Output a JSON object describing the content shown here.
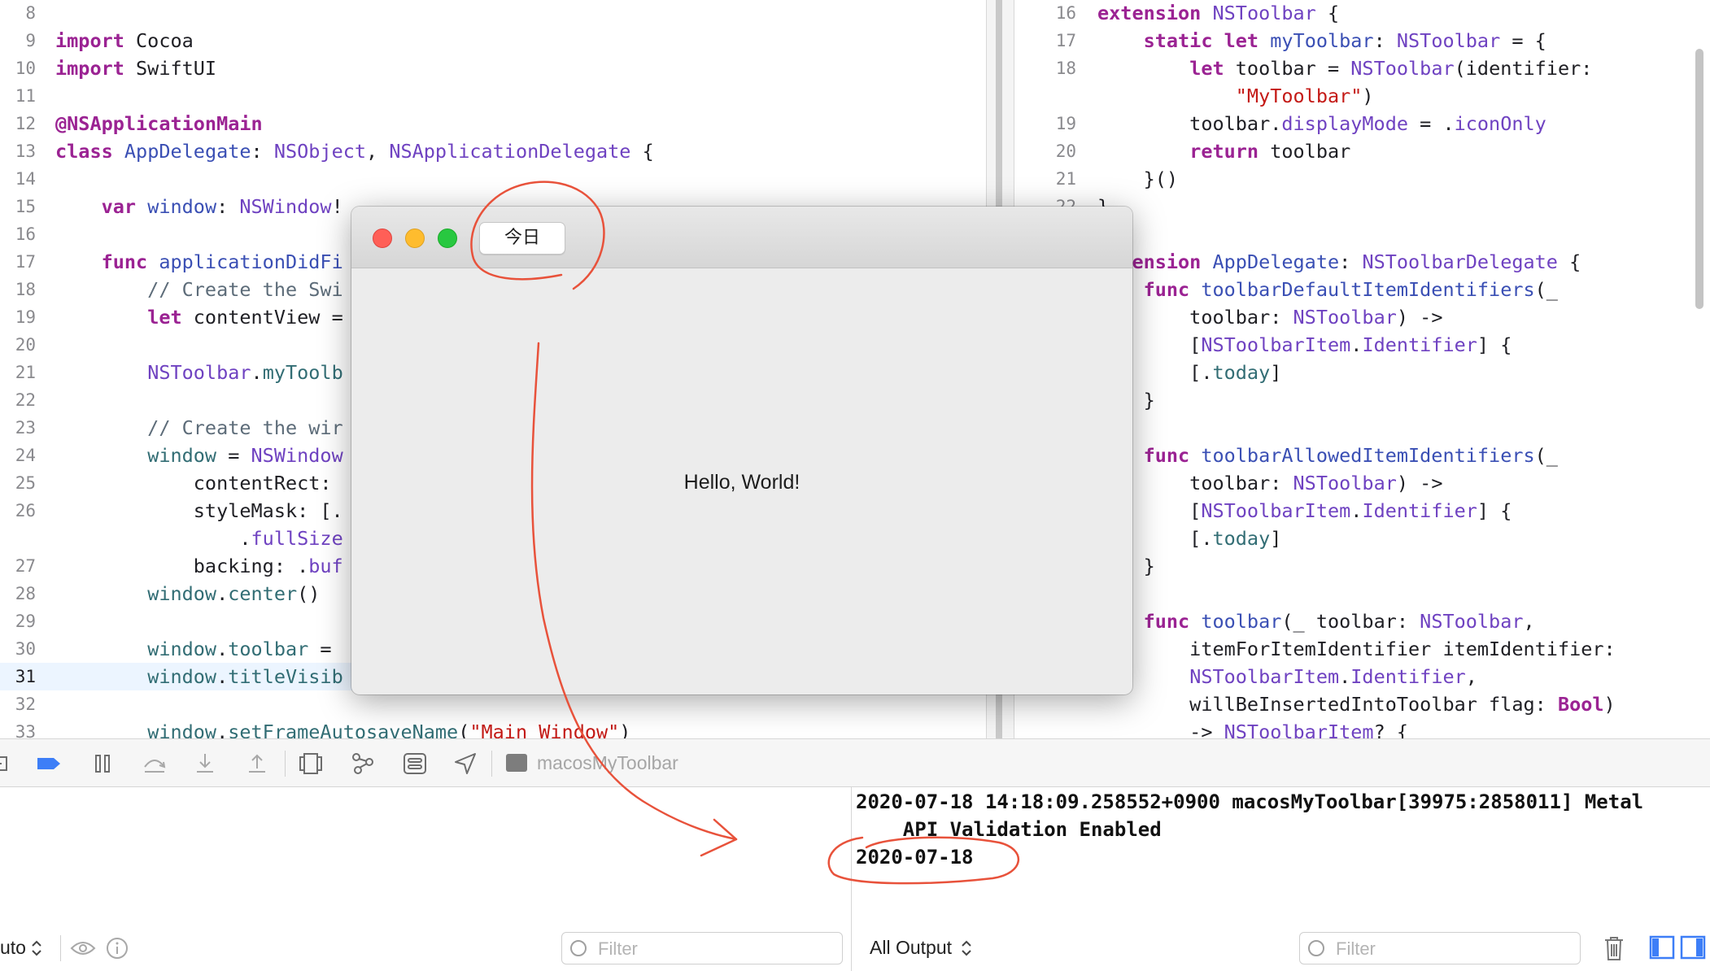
{
  "left_editor": {
    "lines": [
      {
        "num": "8",
        "current": false,
        "tokens": []
      },
      {
        "num": "9",
        "current": false,
        "tokens": [
          {
            "c": "kw",
            "t": "import"
          },
          {
            "c": "pl",
            "t": " Cocoa"
          }
        ]
      },
      {
        "num": "10",
        "current": false,
        "tokens": [
          {
            "c": "kw",
            "t": "import"
          },
          {
            "c": "pl",
            "t": " SwiftUI"
          }
        ]
      },
      {
        "num": "11",
        "current": false,
        "tokens": []
      },
      {
        "num": "12",
        "current": false,
        "tokens": [
          {
            "c": "at",
            "t": "@NSApplicationMain"
          }
        ]
      },
      {
        "num": "13",
        "current": false,
        "tokens": [
          {
            "c": "kw",
            "t": "class"
          },
          {
            "c": "pl",
            "t": " "
          },
          {
            "c": "ty",
            "t": "AppDelegate"
          },
          {
            "c": "pl",
            "t": ": "
          },
          {
            "c": "mt",
            "t": "NSObject"
          },
          {
            "c": "pl",
            "t": ", "
          },
          {
            "c": "mt",
            "t": "NSApplicationDelegate"
          },
          {
            "c": "pl",
            "t": " {"
          }
        ]
      },
      {
        "num": "14",
        "current": false,
        "tokens": []
      },
      {
        "num": "15",
        "current": false,
        "tokens": [
          {
            "c": "pl",
            "t": "    "
          },
          {
            "c": "kw",
            "t": "var"
          },
          {
            "c": "pl",
            "t": " "
          },
          {
            "c": "ty",
            "t": "window"
          },
          {
            "c": "pl",
            "t": ": "
          },
          {
            "c": "mt",
            "t": "NSWindow"
          },
          {
            "c": "pl",
            "t": "!"
          }
        ]
      },
      {
        "num": "16",
        "current": false,
        "tokens": []
      },
      {
        "num": "17",
        "current": false,
        "tokens": [
          {
            "c": "pl",
            "t": "    "
          },
          {
            "c": "kw",
            "t": "func"
          },
          {
            "c": "pl",
            "t": " "
          },
          {
            "c": "ty",
            "t": "applicationDidFi"
          }
        ]
      },
      {
        "num": "18",
        "current": false,
        "tokens": [
          {
            "c": "cm",
            "t": "        // Create the Swi"
          }
        ]
      },
      {
        "num": "19",
        "current": false,
        "tokens": [
          {
            "c": "pl",
            "t": "        "
          },
          {
            "c": "kw",
            "t": "let"
          },
          {
            "c": "pl",
            "t": " contentView ="
          }
        ]
      },
      {
        "num": "20",
        "current": false,
        "tokens": []
      },
      {
        "num": "21",
        "current": false,
        "tokens": [
          {
            "c": "pl",
            "t": "        "
          },
          {
            "c": "mt",
            "t": "NSToolbar"
          },
          {
            "c": "pl",
            "t": "."
          },
          {
            "c": "id",
            "t": "myToolb"
          }
        ]
      },
      {
        "num": "22",
        "current": false,
        "tokens": []
      },
      {
        "num": "23",
        "current": false,
        "tokens": [
          {
            "c": "cm",
            "t": "        // Create the wir"
          }
        ]
      },
      {
        "num": "24",
        "current": false,
        "tokens": [
          {
            "c": "pl",
            "t": "        "
          },
          {
            "c": "id",
            "t": "window"
          },
          {
            "c": "pl",
            "t": " = "
          },
          {
            "c": "mt",
            "t": "NSWindow"
          }
        ]
      },
      {
        "num": "25",
        "current": false,
        "tokens": [
          {
            "c": "pl",
            "t": "            contentRect:"
          }
        ]
      },
      {
        "num": "26",
        "current": false,
        "tokens": [
          {
            "c": "pl",
            "t": "            styleMask: [."
          }
        ]
      },
      {
        "num": "",
        "current": false,
        "tokens": [
          {
            "c": "pl",
            "t": "                ."
          },
          {
            "c": "mt",
            "t": "fullSize"
          }
        ]
      },
      {
        "num": "27",
        "current": false,
        "tokens": [
          {
            "c": "pl",
            "t": "            backing: ."
          },
          {
            "c": "mt",
            "t": "buf"
          }
        ]
      },
      {
        "num": "28",
        "current": false,
        "tokens": [
          {
            "c": "pl",
            "t": "        "
          },
          {
            "c": "id",
            "t": "window"
          },
          {
            "c": "pl",
            "t": "."
          },
          {
            "c": "id",
            "t": "center"
          },
          {
            "c": "pl",
            "t": "()"
          }
        ]
      },
      {
        "num": "29",
        "current": false,
        "tokens": []
      },
      {
        "num": "30",
        "current": false,
        "tokens": [
          {
            "c": "pl",
            "t": "        "
          },
          {
            "c": "id",
            "t": "window"
          },
          {
            "c": "pl",
            "t": "."
          },
          {
            "c": "id",
            "t": "toolbar"
          },
          {
            "c": "pl",
            "t": " ="
          }
        ]
      },
      {
        "num": "31",
        "current": true,
        "tokens": [
          {
            "c": "pl",
            "t": "        "
          },
          {
            "c": "id",
            "t": "window"
          },
          {
            "c": "pl",
            "t": "."
          },
          {
            "c": "id",
            "t": "titleVisib"
          }
        ]
      },
      {
        "num": "32",
        "current": false,
        "tokens": []
      },
      {
        "num": "33",
        "current": false,
        "tokens": [
          {
            "c": "pl",
            "t": "        "
          },
          {
            "c": "id",
            "t": "window"
          },
          {
            "c": "pl",
            "t": "."
          },
          {
            "c": "id",
            "t": "setFrameAutosaveName"
          },
          {
            "c": "pl",
            "t": "("
          },
          {
            "c": "st",
            "t": "\"Main Window\""
          },
          {
            "c": "pl",
            "t": ")"
          }
        ]
      }
    ]
  },
  "right_editor": {
    "lines": [
      {
        "num": "16",
        "tokens": [
          {
            "c": "kw",
            "t": "extension"
          },
          {
            "c": "pl",
            "t": " "
          },
          {
            "c": "mt",
            "t": "NSToolbar"
          },
          {
            "c": "pl",
            "t": " {"
          }
        ]
      },
      {
        "num": "17",
        "tokens": [
          {
            "c": "pl",
            "t": "    "
          },
          {
            "c": "kw",
            "t": "static"
          },
          {
            "c": "pl",
            "t": " "
          },
          {
            "c": "kw",
            "t": "let"
          },
          {
            "c": "pl",
            "t": " "
          },
          {
            "c": "ty",
            "t": "myToolbar"
          },
          {
            "c": "pl",
            "t": ": "
          },
          {
            "c": "mt",
            "t": "NSToolbar"
          },
          {
            "c": "pl",
            "t": " = {"
          }
        ]
      },
      {
        "num": "18",
        "tokens": [
          {
            "c": "pl",
            "t": "        "
          },
          {
            "c": "kw",
            "t": "let"
          },
          {
            "c": "pl",
            "t": " toolbar = "
          },
          {
            "c": "mt",
            "t": "NSToolbar"
          },
          {
            "c": "pl",
            "t": "(identifier:"
          }
        ]
      },
      {
        "num": "",
        "tokens": [
          {
            "c": "pl",
            "t": "            "
          },
          {
            "c": "st",
            "t": "\"MyToolbar\""
          },
          {
            "c": "pl",
            "t": ")"
          }
        ]
      },
      {
        "num": "19",
        "tokens": [
          {
            "c": "pl",
            "t": "        toolbar."
          },
          {
            "c": "mt",
            "t": "displayMode"
          },
          {
            "c": "pl",
            "t": " = ."
          },
          {
            "c": "mt",
            "t": "iconOnly"
          }
        ]
      },
      {
        "num": "20",
        "tokens": [
          {
            "c": "pl",
            "t": "        "
          },
          {
            "c": "kw",
            "t": "return"
          },
          {
            "c": "pl",
            "t": " toolbar"
          }
        ]
      },
      {
        "num": "21",
        "tokens": [
          {
            "c": "pl",
            "t": "    }()"
          }
        ]
      },
      {
        "num": "22",
        "tokens": [
          {
            "c": "pl",
            "t": "}"
          }
        ]
      },
      {
        "num": "",
        "tokens": []
      },
      {
        "num": "",
        "tokens": [
          {
            "c": "kw",
            "t": "extension"
          },
          {
            "c": "pl",
            "t": " "
          },
          {
            "c": "ty",
            "t": "AppDelegate"
          },
          {
            "c": "pl",
            "t": ": "
          },
          {
            "c": "mt",
            "t": "NSToolbarDelegate"
          },
          {
            "c": "pl",
            "t": " {"
          }
        ]
      },
      {
        "num": "",
        "tokens": [
          {
            "c": "pl",
            "t": "    "
          },
          {
            "c": "kw",
            "t": "func"
          },
          {
            "c": "pl",
            "t": " "
          },
          {
            "c": "ty",
            "t": "toolbarDefaultItemIdentifiers"
          },
          {
            "c": "pl",
            "t": "(_"
          }
        ]
      },
      {
        "num": "",
        "tokens": [
          {
            "c": "pl",
            "t": "        toolbar: "
          },
          {
            "c": "mt",
            "t": "NSToolbar"
          },
          {
            "c": "pl",
            "t": ") ->"
          }
        ]
      },
      {
        "num": "",
        "tokens": [
          {
            "c": "pl",
            "t": "        ["
          },
          {
            "c": "mt",
            "t": "NSToolbarItem"
          },
          {
            "c": "pl",
            "t": "."
          },
          {
            "c": "mt",
            "t": "Identifier"
          },
          {
            "c": "pl",
            "t": "] {"
          }
        ]
      },
      {
        "num": "",
        "tokens": [
          {
            "c": "pl",
            "t": "        [."
          },
          {
            "c": "id",
            "t": "today"
          },
          {
            "c": "pl",
            "t": "]"
          }
        ]
      },
      {
        "num": "",
        "tokens": [
          {
            "c": "pl",
            "t": "    }"
          }
        ]
      },
      {
        "num": "",
        "tokens": []
      },
      {
        "num": "",
        "tokens": [
          {
            "c": "pl",
            "t": "    "
          },
          {
            "c": "kw",
            "t": "func"
          },
          {
            "c": "pl",
            "t": " "
          },
          {
            "c": "ty",
            "t": "toolbarAllowedItemIdentifiers"
          },
          {
            "c": "pl",
            "t": "(_"
          }
        ]
      },
      {
        "num": "",
        "tokens": [
          {
            "c": "pl",
            "t": "        toolbar: "
          },
          {
            "c": "mt",
            "t": "NSToolbar"
          },
          {
            "c": "pl",
            "t": ") ->"
          }
        ]
      },
      {
        "num": "",
        "tokens": [
          {
            "c": "pl",
            "t": "        ["
          },
          {
            "c": "mt",
            "t": "NSToolbarItem"
          },
          {
            "c": "pl",
            "t": "."
          },
          {
            "c": "mt",
            "t": "Identifier"
          },
          {
            "c": "pl",
            "t": "] {"
          }
        ]
      },
      {
        "num": "",
        "tokens": [
          {
            "c": "pl",
            "t": "        [."
          },
          {
            "c": "id",
            "t": "today"
          },
          {
            "c": "pl",
            "t": "]"
          }
        ]
      },
      {
        "num": "",
        "tokens": [
          {
            "c": "pl",
            "t": "    }"
          }
        ]
      },
      {
        "num": "",
        "tokens": []
      },
      {
        "num": "",
        "tokens": [
          {
            "c": "pl",
            "t": "    "
          },
          {
            "c": "kw",
            "t": "func"
          },
          {
            "c": "pl",
            "t": " "
          },
          {
            "c": "ty",
            "t": "toolbar"
          },
          {
            "c": "pl",
            "t": "(_ toolbar: "
          },
          {
            "c": "mt",
            "t": "NSToolbar"
          },
          {
            "c": "pl",
            "t": ","
          }
        ]
      },
      {
        "num": "",
        "tokens": [
          {
            "c": "pl",
            "t": "        itemForItemIdentifier itemIdentifier:"
          }
        ]
      },
      {
        "num": "",
        "tokens": [
          {
            "c": "pl",
            "t": "        "
          },
          {
            "c": "mt",
            "t": "NSToolbarItem"
          },
          {
            "c": "pl",
            "t": "."
          },
          {
            "c": "mt",
            "t": "Identifier"
          },
          {
            "c": "pl",
            "t": ","
          }
        ]
      },
      {
        "num": "",
        "tokens": [
          {
            "c": "pl",
            "t": "        willBeInsertedIntoToolbar flag: "
          },
          {
            "c": "kw",
            "t": "Bool"
          },
          {
            "c": "pl",
            "t": ")"
          }
        ]
      },
      {
        "num": "",
        "tokens": [
          {
            "c": "pl",
            "t": "        -> "
          },
          {
            "c": "mt",
            "t": "NSToolbarItem"
          },
          {
            "c": "pl",
            "t": "? {"
          }
        ]
      }
    ]
  },
  "debug_bar": {
    "icons": [
      "breakpoint-toggle-icon",
      "breakpoint-icon",
      "pause-icon",
      "step-over-icon",
      "step-into-icon",
      "step-out-icon",
      "view-hierarchy-icon",
      "memory-graph-icon",
      "environment-overrides-icon",
      "simulate-location-icon"
    ],
    "scheme_name": "macosMyToolbar"
  },
  "variables_panel": {
    "mode_label": "uto",
    "filter_placeholder": "Filter"
  },
  "console": {
    "lines": [
      "2020-07-18 14:18:09.258552+0900 macosMyToolbar[39975:2858011] Metal",
      "    API Validation Enabled",
      "2020-07-18"
    ],
    "output_selector": "All Output",
    "filter_placeholder": "Filter"
  },
  "app_window": {
    "toolbar_button_label": "今日",
    "content_text": "Hello, World!"
  },
  "annotation_color": "#e8523b"
}
